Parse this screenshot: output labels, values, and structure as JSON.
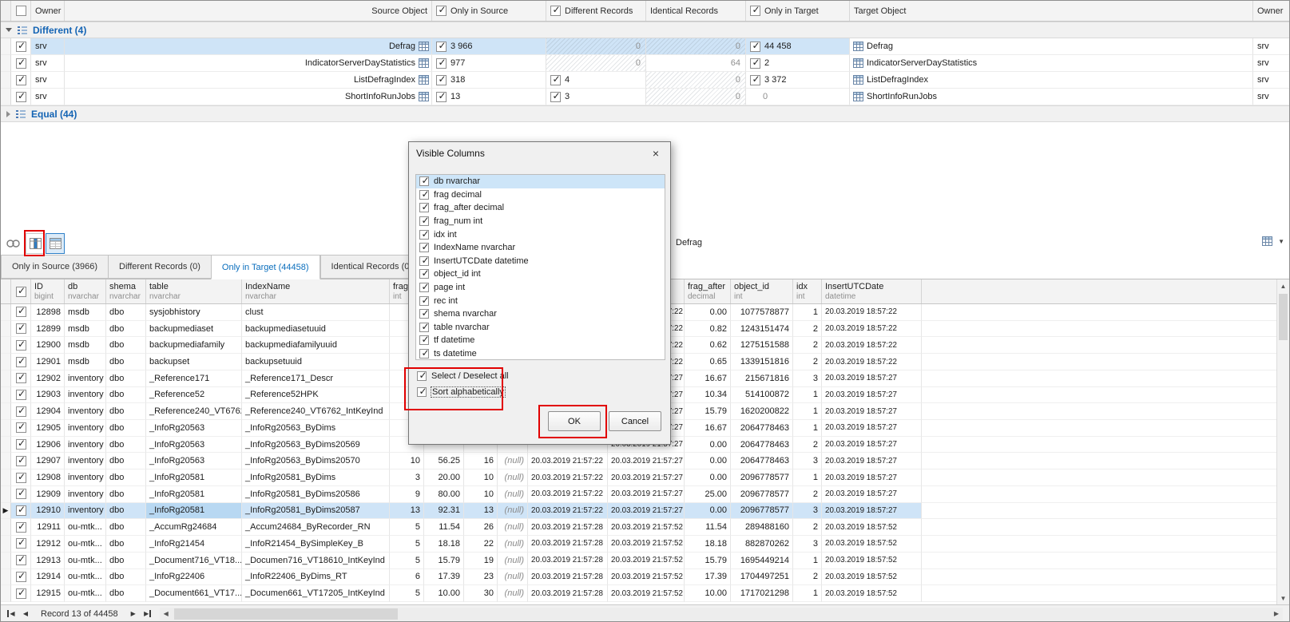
{
  "colors": {
    "accent_blue": "#1464b4",
    "tab_active_text": "#0a6ebd",
    "selection_blue": "#cfe4f7",
    "annotation_red": "#e10000",
    "disabled_gray": "#8f8f8f"
  },
  "glyphs": {
    "close": "×",
    "chevron_down": "▼",
    "nav_prev": "◀",
    "nav_next": "▶",
    "scroll_up": "▲",
    "scroll_down": "▼",
    "scroll_left": "◀",
    "scroll_right": "▶",
    "row_arrow": "▶"
  },
  "top_grid": {
    "header": {
      "owner_left": "Owner",
      "source_object": "Source Object",
      "only_in_source": "Only in Source",
      "different_records": "Different Records",
      "identical_records": "Identical Records",
      "only_in_target": "Only in Target",
      "target_object": "Target Object",
      "owner_right": "Owner"
    },
    "groups": [
      {
        "label": "Different (4)",
        "expanded": true
      },
      {
        "label": "Equal (44)",
        "expanded": false
      }
    ],
    "rows": [
      {
        "selected": true,
        "checked": true,
        "owner": "srv",
        "source": "Defrag",
        "only_in_source": {
          "checked": true,
          "value": "3 966"
        },
        "different": {
          "checked": false,
          "value": "0",
          "hatched": true,
          "align": "right"
        },
        "identical": {
          "checked": false,
          "value": "0",
          "hatched": true,
          "align": "right"
        },
        "only_in_target": {
          "checked": true,
          "value": "44 458"
        },
        "target": "Defrag",
        "owner_right": "srv"
      },
      {
        "selected": false,
        "checked": true,
        "owner": "srv",
        "source": "IndicatorServerDayStatistics",
        "only_in_source": {
          "checked": true,
          "value": "977"
        },
        "different": {
          "checked": false,
          "value": "0",
          "hatched": true,
          "align": "right"
        },
        "identical": {
          "checked": false,
          "value": "64",
          "hatched": false,
          "align": "right"
        },
        "only_in_target": {
          "checked": true,
          "value": "2"
        },
        "target": "IndicatorServerDayStatistics",
        "owner_right": "srv"
      },
      {
        "selected": false,
        "checked": true,
        "owner": "srv",
        "source": "ListDefragIndex",
        "only_in_source": {
          "checked": true,
          "value": "318"
        },
        "different": {
          "checked": true,
          "value": "4"
        },
        "identical": {
          "checked": false,
          "value": "0",
          "hatched": true,
          "align": "right"
        },
        "only_in_target": {
          "checked": true,
          "value": "3 372"
        },
        "target": "ListDefragIndex",
        "owner_right": "srv"
      },
      {
        "selected": false,
        "checked": true,
        "owner": "srv",
        "source": "ShortInfoRunJobs",
        "only_in_source": {
          "checked": true,
          "value": "13"
        },
        "different": {
          "checked": true,
          "value": "3"
        },
        "identical": {
          "checked": false,
          "value": "0",
          "hatched": true,
          "align": "right"
        },
        "only_in_target": {
          "checked": false,
          "value": "0",
          "hatched": false,
          "align": "left"
        },
        "target": "ShortInfoRunJobs",
        "owner_right": "srv"
      }
    ]
  },
  "toolbar": {
    "pane_title": "Defrag"
  },
  "tabs": [
    {
      "label": "Only in Source (3966)",
      "active": false
    },
    {
      "label": "Different Records (0)",
      "active": false
    },
    {
      "label": "Only in Target (44458)",
      "active": true
    },
    {
      "label": "Identical Records (0)",
      "active": false
    }
  ],
  "grid": {
    "columns": [
      {
        "label": "ID",
        "type": "bigint"
      },
      {
        "label": "db",
        "type": "nvarchar"
      },
      {
        "label": "shema",
        "type": "nvarchar"
      },
      {
        "label": "table",
        "type": "nvarchar"
      },
      {
        "label": "IndexName",
        "type": "nvarchar"
      },
      {
        "label": "frag_num",
        "type": "int"
      },
      {
        "label": "frag",
        "type": "decimal"
      },
      {
        "label": "page",
        "type": "int"
      },
      {
        "label": "rec",
        "type": "int"
      },
      {
        "label": "tf",
        "type": "datetime"
      },
      {
        "label": "ts",
        "type": "datetime"
      },
      {
        "label": "frag_after",
        "type": "decimal"
      },
      {
        "label": "object_id",
        "type": "int"
      },
      {
        "label": "idx",
        "type": "int"
      },
      {
        "label": "InsertUTCDate",
        "type": "datetime"
      }
    ],
    "rows": [
      {
        "selected": false,
        "cells": [
          "12898",
          "msdb",
          "dbo",
          "sysjobhistory",
          "clust",
          "",
          "",
          "",
          "",
          "",
          "20.03.2019 21:57:22",
          "0.00",
          "1077578877",
          "1",
          "20.03.2019 18:57:22"
        ]
      },
      {
        "selected": false,
        "cells": [
          "12899",
          "msdb",
          "dbo",
          "backupmediaset",
          "backupmediasetuuid",
          "",
          "",
          "",
          "",
          "",
          "20.03.2019 21:57:22",
          "0.82",
          "1243151474",
          "2",
          "20.03.2019 18:57:22"
        ]
      },
      {
        "selected": false,
        "cells": [
          "12900",
          "msdb",
          "dbo",
          "backupmediafamily",
          "backupmediafamilyuuid",
          "",
          "",
          "",
          "",
          "",
          "20.03.2019 21:57:22",
          "0.62",
          "1275151588",
          "2",
          "20.03.2019 18:57:22"
        ]
      },
      {
        "selected": false,
        "cells": [
          "12901",
          "msdb",
          "dbo",
          "backupset",
          "backupsetuuid",
          "",
          "",
          "",
          "",
          "",
          "20.03.2019 21:57:22",
          "0.65",
          "1339151816",
          "2",
          "20.03.2019 18:57:22"
        ]
      },
      {
        "selected": false,
        "cells": [
          "12902",
          "inventory",
          "dbo",
          "_Reference171",
          "_Reference171_Descr",
          "",
          "",
          "",
          "",
          "",
          "20.03.2019 21:57:27",
          "16.67",
          "215671816",
          "3",
          "20.03.2019 18:57:27"
        ]
      },
      {
        "selected": false,
        "cells": [
          "12903",
          "inventory",
          "dbo",
          "_Reference52",
          "_Reference52HPK",
          "",
          "",
          "",
          "",
          "",
          "20.03.2019 21:57:27",
          "10.34",
          "514100872",
          "1",
          "20.03.2019 18:57:27"
        ]
      },
      {
        "selected": false,
        "cells": [
          "12904",
          "inventory",
          "dbo",
          "_Reference240_VT6762",
          "_Reference240_VT6762_IntKeyInd",
          "",
          "",
          "",
          "",
          "",
          "20.03.2019 21:57:27",
          "15.79",
          "1620200822",
          "1",
          "20.03.2019 18:57:27"
        ]
      },
      {
        "selected": false,
        "cells": [
          "12905",
          "inventory",
          "dbo",
          "_InfoRg20563",
          "_InfoRg20563_ByDims",
          "",
          "",
          "",
          "",
          "",
          "20.03.2019 21:57:27",
          "16.67",
          "2064778463",
          "1",
          "20.03.2019 18:57:27"
        ]
      },
      {
        "selected": false,
        "cells": [
          "12906",
          "inventory",
          "dbo",
          "_InfoRg20563",
          "_InfoRg20563_ByDims20569",
          "",
          "",
          "",
          "",
          "",
          "20.03.2019 21:57:27",
          "0.00",
          "2064778463",
          "2",
          "20.03.2019 18:57:27"
        ]
      },
      {
        "selected": false,
        "cells": [
          "12907",
          "inventory",
          "dbo",
          "_InfoRg20563",
          "_InfoRg20563_ByDims20570",
          "10",
          "56.25",
          "16",
          "(null)",
          "20.03.2019 21:57:22",
          "20.03.2019 21:57:27",
          "0.00",
          "2064778463",
          "3",
          "20.03.2019 18:57:27"
        ]
      },
      {
        "selected": false,
        "cells": [
          "12908",
          "inventory",
          "dbo",
          "_InfoRg20581",
          "_InfoRg20581_ByDims",
          "3",
          "20.00",
          "10",
          "(null)",
          "20.03.2019 21:57:22",
          "20.03.2019 21:57:27",
          "0.00",
          "2096778577",
          "1",
          "20.03.2019 18:57:27"
        ]
      },
      {
        "selected": false,
        "cells": [
          "12909",
          "inventory",
          "dbo",
          "_InfoRg20581",
          "_InfoRg20581_ByDims20586",
          "9",
          "80.00",
          "10",
          "(null)",
          "20.03.2019 21:57:22",
          "20.03.2019 21:57:27",
          "25.00",
          "2096778577",
          "2",
          "20.03.2019 18:57:27"
        ]
      },
      {
        "selected": true,
        "cells": [
          "12910",
          "inventory",
          "dbo",
          "_InfoRg20581",
          "_InfoRg20581_ByDims20587",
          "13",
          "92.31",
          "13",
          "(null)",
          "20.03.2019 21:57:22",
          "20.03.2019 21:57:27",
          "0.00",
          "2096778577",
          "3",
          "20.03.2019 18:57:27"
        ]
      },
      {
        "selected": false,
        "cells": [
          "12911",
          "ou-mtk...",
          "dbo",
          "_AccumRg24684",
          "_Accum24684_ByRecorder_RN",
          "5",
          "11.54",
          "26",
          "(null)",
          "20.03.2019 21:57:28",
          "20.03.2019 21:57:52",
          "11.54",
          "289488160",
          "2",
          "20.03.2019 18:57:52"
        ]
      },
      {
        "selected": false,
        "cells": [
          "12912",
          "ou-mtk...",
          "dbo",
          "_InfoRg21454",
          "_InfoR21454_BySimpleKey_B",
          "5",
          "18.18",
          "22",
          "(null)",
          "20.03.2019 21:57:28",
          "20.03.2019 21:57:52",
          "18.18",
          "882870262",
          "3",
          "20.03.2019 18:57:52"
        ]
      },
      {
        "selected": false,
        "cells": [
          "12913",
          "ou-mtk...",
          "dbo",
          "_Document716_VT18...",
          "_Documen716_VT18610_IntKeyInd",
          "5",
          "15.79",
          "19",
          "(null)",
          "20.03.2019 21:57:28",
          "20.03.2019 21:57:52",
          "15.79",
          "1695449214",
          "1",
          "20.03.2019 18:57:52"
        ]
      },
      {
        "selected": false,
        "cells": [
          "12914",
          "ou-mtk...",
          "dbo",
          "_InfoRg22406",
          "_InfoR22406_ByDims_RT",
          "6",
          "17.39",
          "23",
          "(null)",
          "20.03.2019 21:57:28",
          "20.03.2019 21:57:52",
          "17.39",
          "1704497251",
          "2",
          "20.03.2019 18:57:52"
        ]
      },
      {
        "selected": false,
        "cells": [
          "12915",
          "ou-mtk...",
          "dbo",
          "_Document661_VT17...",
          "_Documen661_VT17205_IntKeyInd",
          "5",
          "10.00",
          "30",
          "(null)",
          "20.03.2019 21:57:28",
          "20.03.2019 21:57:52",
          "10.00",
          "1717021298",
          "1",
          "20.03.2019 18:57:52"
        ]
      }
    ]
  },
  "dialog": {
    "title": "Visible Columns",
    "items": [
      {
        "label": "db nvarchar",
        "checked": true,
        "selected": true
      },
      {
        "label": "frag decimal",
        "checked": true
      },
      {
        "label": "frag_after decimal",
        "checked": true
      },
      {
        "label": "frag_num int",
        "checked": true
      },
      {
        "label": "idx int",
        "checked": true
      },
      {
        "label": "IndexName nvarchar",
        "checked": true
      },
      {
        "label": "InsertUTCDate datetime",
        "checked": true
      },
      {
        "label": "object_id int",
        "checked": true
      },
      {
        "label": "page int",
        "checked": true
      },
      {
        "label": "rec int",
        "checked": true
      },
      {
        "label": "shema nvarchar",
        "checked": true
      },
      {
        "label": "table nvarchar",
        "checked": true
      },
      {
        "label": "tf datetime",
        "checked": true
      },
      {
        "label": "ts datetime",
        "checked": true
      }
    ],
    "select_all": {
      "label": "Select / Deselect all",
      "checked": true
    },
    "sort_alpha": {
      "label": "Sort alphabetically",
      "checked": true
    },
    "ok_label": "OK",
    "cancel_label": "Cancel"
  },
  "status_bar": {
    "record_label": "Record 13 of 44458"
  }
}
